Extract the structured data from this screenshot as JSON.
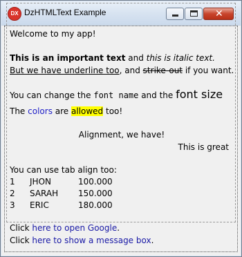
{
  "window": {
    "title": "DzHTMLText Example",
    "icon_text": "DX",
    "close_glyph": "✕"
  },
  "content": {
    "welcome": "Welcome to my app!",
    "important": "This is an important text",
    "and_1": " and ",
    "italic": "this is italic text.",
    "underline": "But we have underline too",
    "and_2": ", and ",
    "strike": "strike-out",
    "if_you_want": " if you want.",
    "change_prefix": "You can change the ",
    "font_name": "font name",
    "and_the": " and the ",
    "font_size": "font size",
    "the": "The ",
    "colors": "colors",
    "are": " are ",
    "allowed": "allowed",
    "too": " too!",
    "alignment": "Alignment, we have!",
    "great": "This is great",
    "tab_intro": "You can use tab align too:",
    "rows": [
      {
        "num": "1",
        "name": "JHON",
        "value": "100.000"
      },
      {
        "num": "2",
        "name": "SARAH",
        "value": "150.000"
      },
      {
        "num": "3",
        "name": "ERIC",
        "value": "180.000"
      }
    ],
    "click_1": "Click ",
    "google_link": "here to open Google",
    "period_1": ".",
    "click_2": "Click ",
    "msgbox_link": "here to show a message box",
    "period_2": "."
  }
}
